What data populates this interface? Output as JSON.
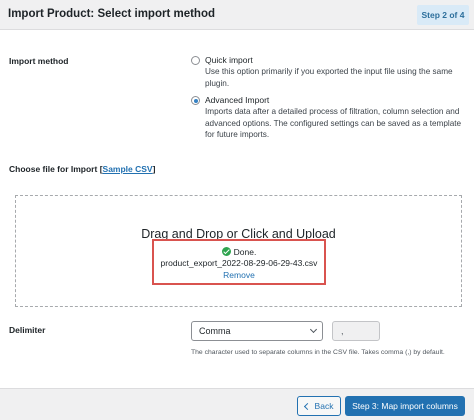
{
  "header": {
    "title": "Import Product: Select import method",
    "step": "Step 2 of 4"
  },
  "import_method": {
    "label": "Import method",
    "options": [
      {
        "title": "Quick import",
        "description": "Use this option primarily if you exported the input file using the same plugin.",
        "checked": false
      },
      {
        "title": "Advanced Import",
        "description": "Imports data after a detailed process of filtration, column selection and advanced options. The configured settings can be saved as a template for future imports.",
        "checked": true
      }
    ]
  },
  "file": {
    "label": "Choose file for Import",
    "open_bracket": "[",
    "sample_link": "Sample CSV",
    "close_bracket": "]",
    "dropzone_title": "Drag and Drop or Click and Upload",
    "status": "Done.",
    "filename": "product_export_2022-08-29-06-29-43.csv",
    "remove": "Remove"
  },
  "delimiter": {
    "label": "Delimiter",
    "selected": "Comma",
    "value": ",",
    "help": "The character used to separate columns in the CSV file. Takes comma (,) by default."
  },
  "footer": {
    "back": "Back",
    "next": "Step 3: Map import columns"
  },
  "colors": {
    "primary": "#2271b1",
    "highlight_border": "#d9534f",
    "success": "#2fa44f",
    "step_badge_bg": "#d9eaf7"
  }
}
